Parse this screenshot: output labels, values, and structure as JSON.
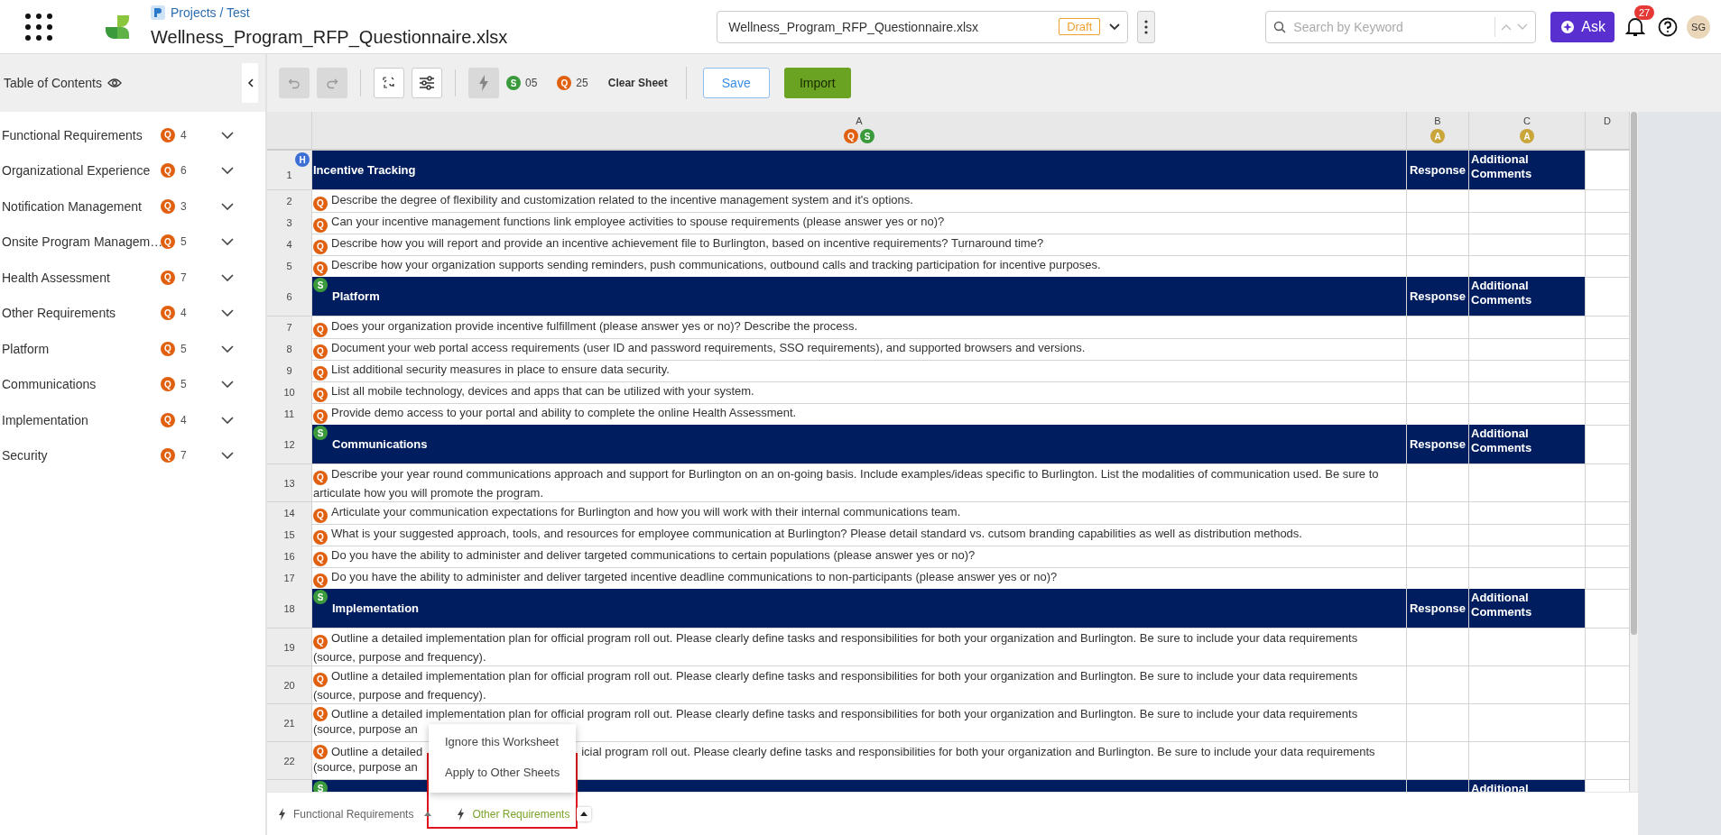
{
  "header": {
    "breadcrumb": "Projects / Test",
    "title": "Wellness_Program_RFP_Questionnaire.xlsx"
  },
  "file_select": {
    "value": "Wellness_Program_RFP_Questionnaire.xlsx",
    "status": "Draft"
  },
  "search": {
    "placeholder": "Search by Keyword"
  },
  "ask_button": "Ask",
  "notifications": {
    "count": "27"
  },
  "avatar": "SG",
  "toc": {
    "title": "Table of Contents",
    "items": [
      {
        "label": "Functional Requirements",
        "tag": {
          "kind": "question",
          "letter": "Q"
        },
        "count": "4",
        "expanded": false
      },
      {
        "label": "Organizational Experience",
        "tag": {
          "kind": "question",
          "letter": "Q"
        },
        "count": "6",
        "expanded": false
      },
      {
        "label": "Notification Management",
        "tag": {
          "kind": "question",
          "letter": "Q"
        },
        "count": "3",
        "expanded": false
      },
      {
        "label": "Onsite Program Managem…",
        "tag": {
          "kind": "question",
          "letter": "Q"
        },
        "count": "5",
        "expanded": false
      },
      {
        "label": "Health Assessment",
        "tag": {
          "kind": "question",
          "letter": "Q"
        },
        "count": "7",
        "expanded": false
      },
      {
        "label": "Other Requirements",
        "tag": {
          "kind": "question",
          "letter": "Q"
        },
        "count": "4",
        "expanded": false
      },
      {
        "label": "Platform",
        "tag": {
          "kind": "question",
          "letter": "Q"
        },
        "count": "5",
        "expanded": false
      },
      {
        "label": "Communications",
        "tag": {
          "kind": "question",
          "letter": "Q"
        },
        "count": "5",
        "expanded": false
      },
      {
        "label": "Implementation",
        "tag": {
          "kind": "question",
          "letter": "Q"
        },
        "count": "4",
        "expanded": false
      },
      {
        "label": "Security",
        "tag": {
          "kind": "question",
          "letter": "Q"
        },
        "count": "7",
        "expanded": false
      }
    ]
  },
  "toolbar": {
    "tools": [
      {
        "kind": "undo",
        "disabled": true
      },
      {
        "kind": "redo",
        "disabled": true
      },
      {
        "kind": "translate",
        "disabled": false
      },
      {
        "kind": "filters",
        "disabled": false
      },
      {
        "kind": "lightning",
        "disabled": true
      }
    ],
    "counters": [
      {
        "kind": "section",
        "letter": "S",
        "count": "05"
      },
      {
        "kind": "question",
        "letter": "Q",
        "count": "25"
      }
    ],
    "clear_label": "Clear Sheet",
    "save_label": "Save",
    "import_label": "Import"
  },
  "sheet": {
    "columns": [
      {
        "label": "A",
        "tags": [
          {
            "kind": "question",
            "letter": "Q"
          },
          {
            "kind": "section",
            "letter": "S"
          }
        ]
      },
      {
        "label": "B",
        "tags": [
          {
            "kind": "answer",
            "letter": "A"
          }
        ]
      },
      {
        "label": "C",
        "tags": [
          {
            "kind": "answer",
            "letter": "A"
          }
        ]
      },
      {
        "label": "D"
      }
    ],
    "rows": [
      {
        "number": "1",
        "kind": "title",
        "tag": {
          "kind": "header",
          "letter": "H"
        },
        "a": "Incentive Tracking",
        "b": "Response",
        "c": "Additional Comments"
      },
      {
        "number": "2",
        "kind": "question",
        "tag": {
          "kind": "question",
          "letter": "Q"
        },
        "a": "Describe the degree of flexibility and customization related to the incentive management system and it's options."
      },
      {
        "number": "3",
        "kind": "question",
        "tag": {
          "kind": "question",
          "letter": "Q"
        },
        "a": "Can your incentive management functions link employee activities to spouse requirements (please answer yes or no)?"
      },
      {
        "number": "4",
        "kind": "question",
        "tag": {
          "kind": "question",
          "letter": "Q"
        },
        "a": "Describe how you will report and provide an incentive achievement file to Burlington, based on incentive requirements? Turnaround time?"
      },
      {
        "number": "5",
        "kind": "question",
        "tag": {
          "kind": "question",
          "letter": "Q"
        },
        "a": "Describe how your organization supports sending reminders, push communications, outbound calls and tracking participation for incentive purposes."
      },
      {
        "number": "6",
        "kind": "section",
        "tag": {
          "kind": "section",
          "letter": "S"
        },
        "a": "Platform",
        "b": "Response",
        "c": "Additional Comments"
      },
      {
        "number": "7",
        "kind": "question",
        "tag": {
          "kind": "question",
          "letter": "Q"
        },
        "a": "Does your organization provide incentive fulfillment (please answer yes or no)? Describe the process."
      },
      {
        "number": "8",
        "kind": "question",
        "tag": {
          "kind": "question",
          "letter": "Q"
        },
        "a": "Document your web portal access requirements (user ID and password requirements, SSO requirements), and supported browsers and versions."
      },
      {
        "number": "9",
        "kind": "question",
        "tag": {
          "kind": "question",
          "letter": "Q"
        },
        "a": "List additional security measures in place to ensure data security."
      },
      {
        "number": "10",
        "kind": "question",
        "tag": {
          "kind": "question",
          "letter": "Q"
        },
        "a": "List all mobile technology, devices and apps that can be utilized with your system."
      },
      {
        "number": "11",
        "kind": "question",
        "tag": {
          "kind": "question",
          "letter": "Q"
        },
        "a": "Provide demo access to your portal and ability to complete the online Health Assessment."
      },
      {
        "number": "12",
        "kind": "section",
        "tag": {
          "kind": "section",
          "letter": "S"
        },
        "a": "Communications",
        "b": "Response",
        "c": "Additional Comments"
      },
      {
        "number": "13",
        "kind": "question",
        "tag": {
          "kind": "question",
          "letter": "Q"
        },
        "a": "Describe your year round communications approach and support for Burlington on an on-going basis. Include examples/ideas specific to Burlington. List the modalities of communication used. Be sure to articulate how you will promote the program."
      },
      {
        "number": "14",
        "kind": "question",
        "tag": {
          "kind": "question",
          "letter": "Q"
        },
        "a": "Articulate your communication expectations for Burlington and how you will work with their internal communications team."
      },
      {
        "number": "15",
        "kind": "question",
        "tag": {
          "kind": "question",
          "letter": "Q"
        },
        "a": "What is your suggested approach, tools, and resources for employee communication at Burlington? Please detail standard vs. cutsom branding capabilities as well as distribution methods."
      },
      {
        "number": "16",
        "kind": "question",
        "tag": {
          "kind": "question",
          "letter": "Q"
        },
        "a": "Do you have the ability to administer and deliver targeted communications to certain populations (please answer yes or no)?"
      },
      {
        "number": "17",
        "kind": "question",
        "tag": {
          "kind": "question",
          "letter": "Q"
        },
        "a": "Do you have the ability to administer and deliver targeted incentive deadline communications to non-participants (please answer yes or no)?"
      },
      {
        "number": "18",
        "kind": "section",
        "tag": {
          "kind": "section",
          "letter": "S"
        },
        "a": "Implementation",
        "b": "Response",
        "c": "Additional Comments"
      },
      {
        "number": "19",
        "kind": "question",
        "tag": {
          "kind": "question",
          "letter": "Q"
        },
        "a": "Outline a detailed implementation plan for official program roll out. Please clearly define tasks and responsibilities for both your organization and Burlington. Be sure to include your data requirements (source, purpose and frequency)."
      },
      {
        "number": "20",
        "kind": "question",
        "tag": {
          "kind": "question",
          "letter": "Q"
        },
        "a": "Outline a detailed implementation plan for official program roll out. Please clearly define tasks and responsibilities for both your organization and Burlington. Be sure to include your data requirements (source, purpose and frequency)."
      },
      {
        "number": "21",
        "kind": "partial",
        "tag": {
          "kind": "question",
          "letter": "Q"
        },
        "lines": [
          [
            "Outline a detailed implementation plan for official program roll out. Please clearly define tasks and responsibilities for both your organization and Burlington. Be sure to include your data requirements"
          ],
          [
            "(source, purpose an"
          ]
        ]
      },
      {
        "number": "22",
        "kind": "partial",
        "tag": {
          "kind": "question",
          "letter": "Q"
        },
        "lines": [
          [
            "Outline a detailed",
            "icial program roll out. Please clearly define tasks and responsibilities for both your organization and Burlington. Be sure to include your data requirements"
          ],
          [
            "(source, purpose an"
          ]
        ]
      },
      {
        "kind": "section",
        "tag": {
          "kind": "section",
          "letter": "S"
        },
        "c": "Additional"
      }
    ]
  },
  "menu": {
    "items": [
      {
        "label": "Ignore this Worksheet"
      },
      {
        "label": "Apply to Other Sheets"
      }
    ],
    "framed": true
  },
  "sheet_tabs": [
    {
      "label": "Functional Requirements",
      "selected": false
    },
    {
      "label": "Other Requirements",
      "selected": true
    }
  ]
}
